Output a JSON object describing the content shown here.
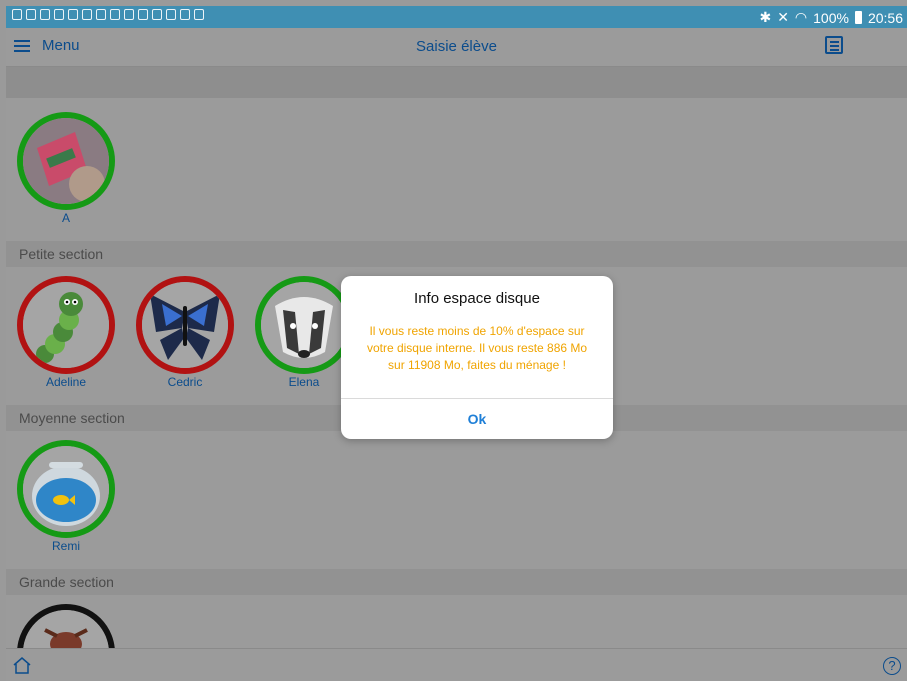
{
  "status": {
    "battery": "100%",
    "time": "20:56"
  },
  "appbar": {
    "menu_label": "Menu",
    "title": "Saisie élève"
  },
  "sections": [
    {
      "label": "Petite section"
    },
    {
      "label": "Moyenne section"
    },
    {
      "label": "Grande section"
    }
  ],
  "students": [
    {
      "name": "A"
    },
    {
      "name": "Adeline"
    },
    {
      "name": "Cedric"
    },
    {
      "name": "Elena"
    },
    {
      "name": "Remi"
    }
  ],
  "dialog": {
    "title": "Info espace disque",
    "message": "Il vous reste moins de 10% d'espace sur votre disque interne. Il vous reste 886 Mo sur 11908 Mo, faites du ménage !",
    "ok_label": "Ok"
  },
  "footer": {
    "help_label": "?"
  },
  "colors": {
    "present": "#159a15",
    "absent": "#b11212",
    "accent": "#0b4c8c",
    "warning": "#f0a400"
  }
}
